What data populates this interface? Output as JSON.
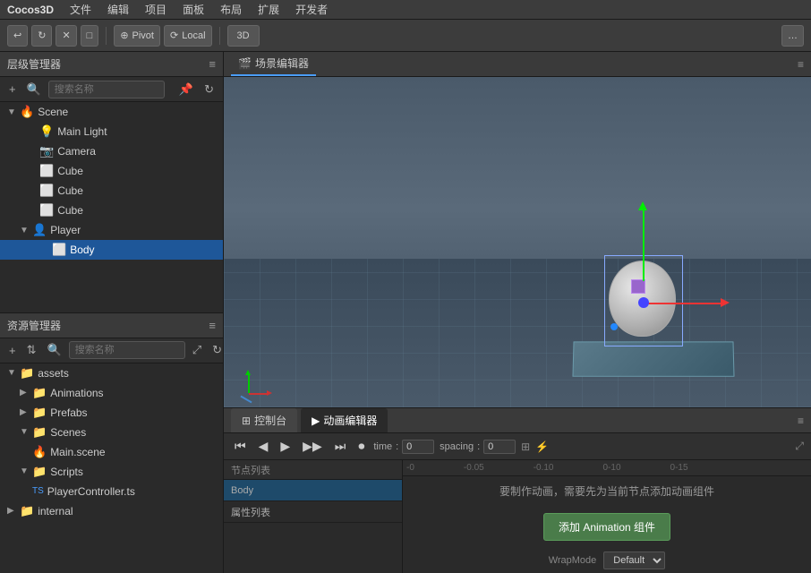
{
  "menubar": {
    "appname": "Cocos3D",
    "items": [
      "文件",
      "编辑",
      "项目",
      "面板",
      "布局",
      "扩展",
      "开发者"
    ]
  },
  "toolbar": {
    "buttons": [
      "↩",
      "↻",
      "✕",
      "□"
    ],
    "pivot_label": "Pivot",
    "local_label": "Local",
    "view3d_label": "3D",
    "right_btn": "…"
  },
  "hierarchy": {
    "panel_title": "层级管理器",
    "search_placeholder": "搜索名称",
    "scene_label": "Scene",
    "items": [
      {
        "name": "Main Light",
        "indent": 1,
        "icon": "📋",
        "type": "light"
      },
      {
        "name": "Camera",
        "indent": 1,
        "icon": "📷",
        "type": "camera"
      },
      {
        "name": "Cube",
        "indent": 1,
        "icon": "⬜",
        "type": "cube"
      },
      {
        "name": "Cube",
        "indent": 1,
        "icon": "⬜",
        "type": "cube"
      },
      {
        "name": "Cube",
        "indent": 1,
        "icon": "⬜",
        "type": "cube"
      },
      {
        "name": "Player",
        "indent": 1,
        "icon": "👤",
        "type": "player",
        "expanded": true
      },
      {
        "name": "Body",
        "indent": 2,
        "icon": "⬜",
        "type": "body",
        "selected": true
      }
    ]
  },
  "assets": {
    "panel_title": "资源管理器",
    "search_placeholder": "搜索名称",
    "items": [
      {
        "name": "assets",
        "indent": 0,
        "type": "folder",
        "expanded": true
      },
      {
        "name": "Animations",
        "indent": 1,
        "type": "folder",
        "expanded": false
      },
      {
        "name": "Prefabs",
        "indent": 1,
        "type": "folder",
        "expanded": false
      },
      {
        "name": "Scenes",
        "indent": 1,
        "type": "folder",
        "expanded": true
      },
      {
        "name": "Main.scene",
        "indent": 2,
        "type": "scene"
      },
      {
        "name": "Scripts",
        "indent": 1,
        "type": "folder",
        "expanded": true
      },
      {
        "name": "PlayerController.ts",
        "indent": 2,
        "type": "typescript"
      },
      {
        "name": "internal",
        "indent": 0,
        "type": "folder",
        "expanded": false
      }
    ]
  },
  "scene_editor": {
    "tab_label": "场景编辑器",
    "menu_icon": "≡"
  },
  "animation_editor": {
    "tab_control_label": "控制台",
    "tab_anim_label": "动画编辑器",
    "menu_icon": "≡",
    "time_label": "time",
    "time_value": "0",
    "spacing_label": "spacing",
    "spacing_value": "0",
    "node_list_label": "节点列表",
    "props_list_label": "属性列表",
    "overlay_text": "要制作动画，需要先为当前节点添加动画组件",
    "add_btn_label": "添加 Animation 组件",
    "wrap_mode_label": "WrapMode",
    "wrap_mode_value": "Default",
    "selected_node": "Body",
    "timeline_markers": [
      "0",
      "-0.05",
      "-0.10",
      "0-10",
      "0-15"
    ],
    "timeline_display": [
      "-0",
      "-0.05",
      "-0.10",
      "0-10",
      "0-15"
    ]
  }
}
